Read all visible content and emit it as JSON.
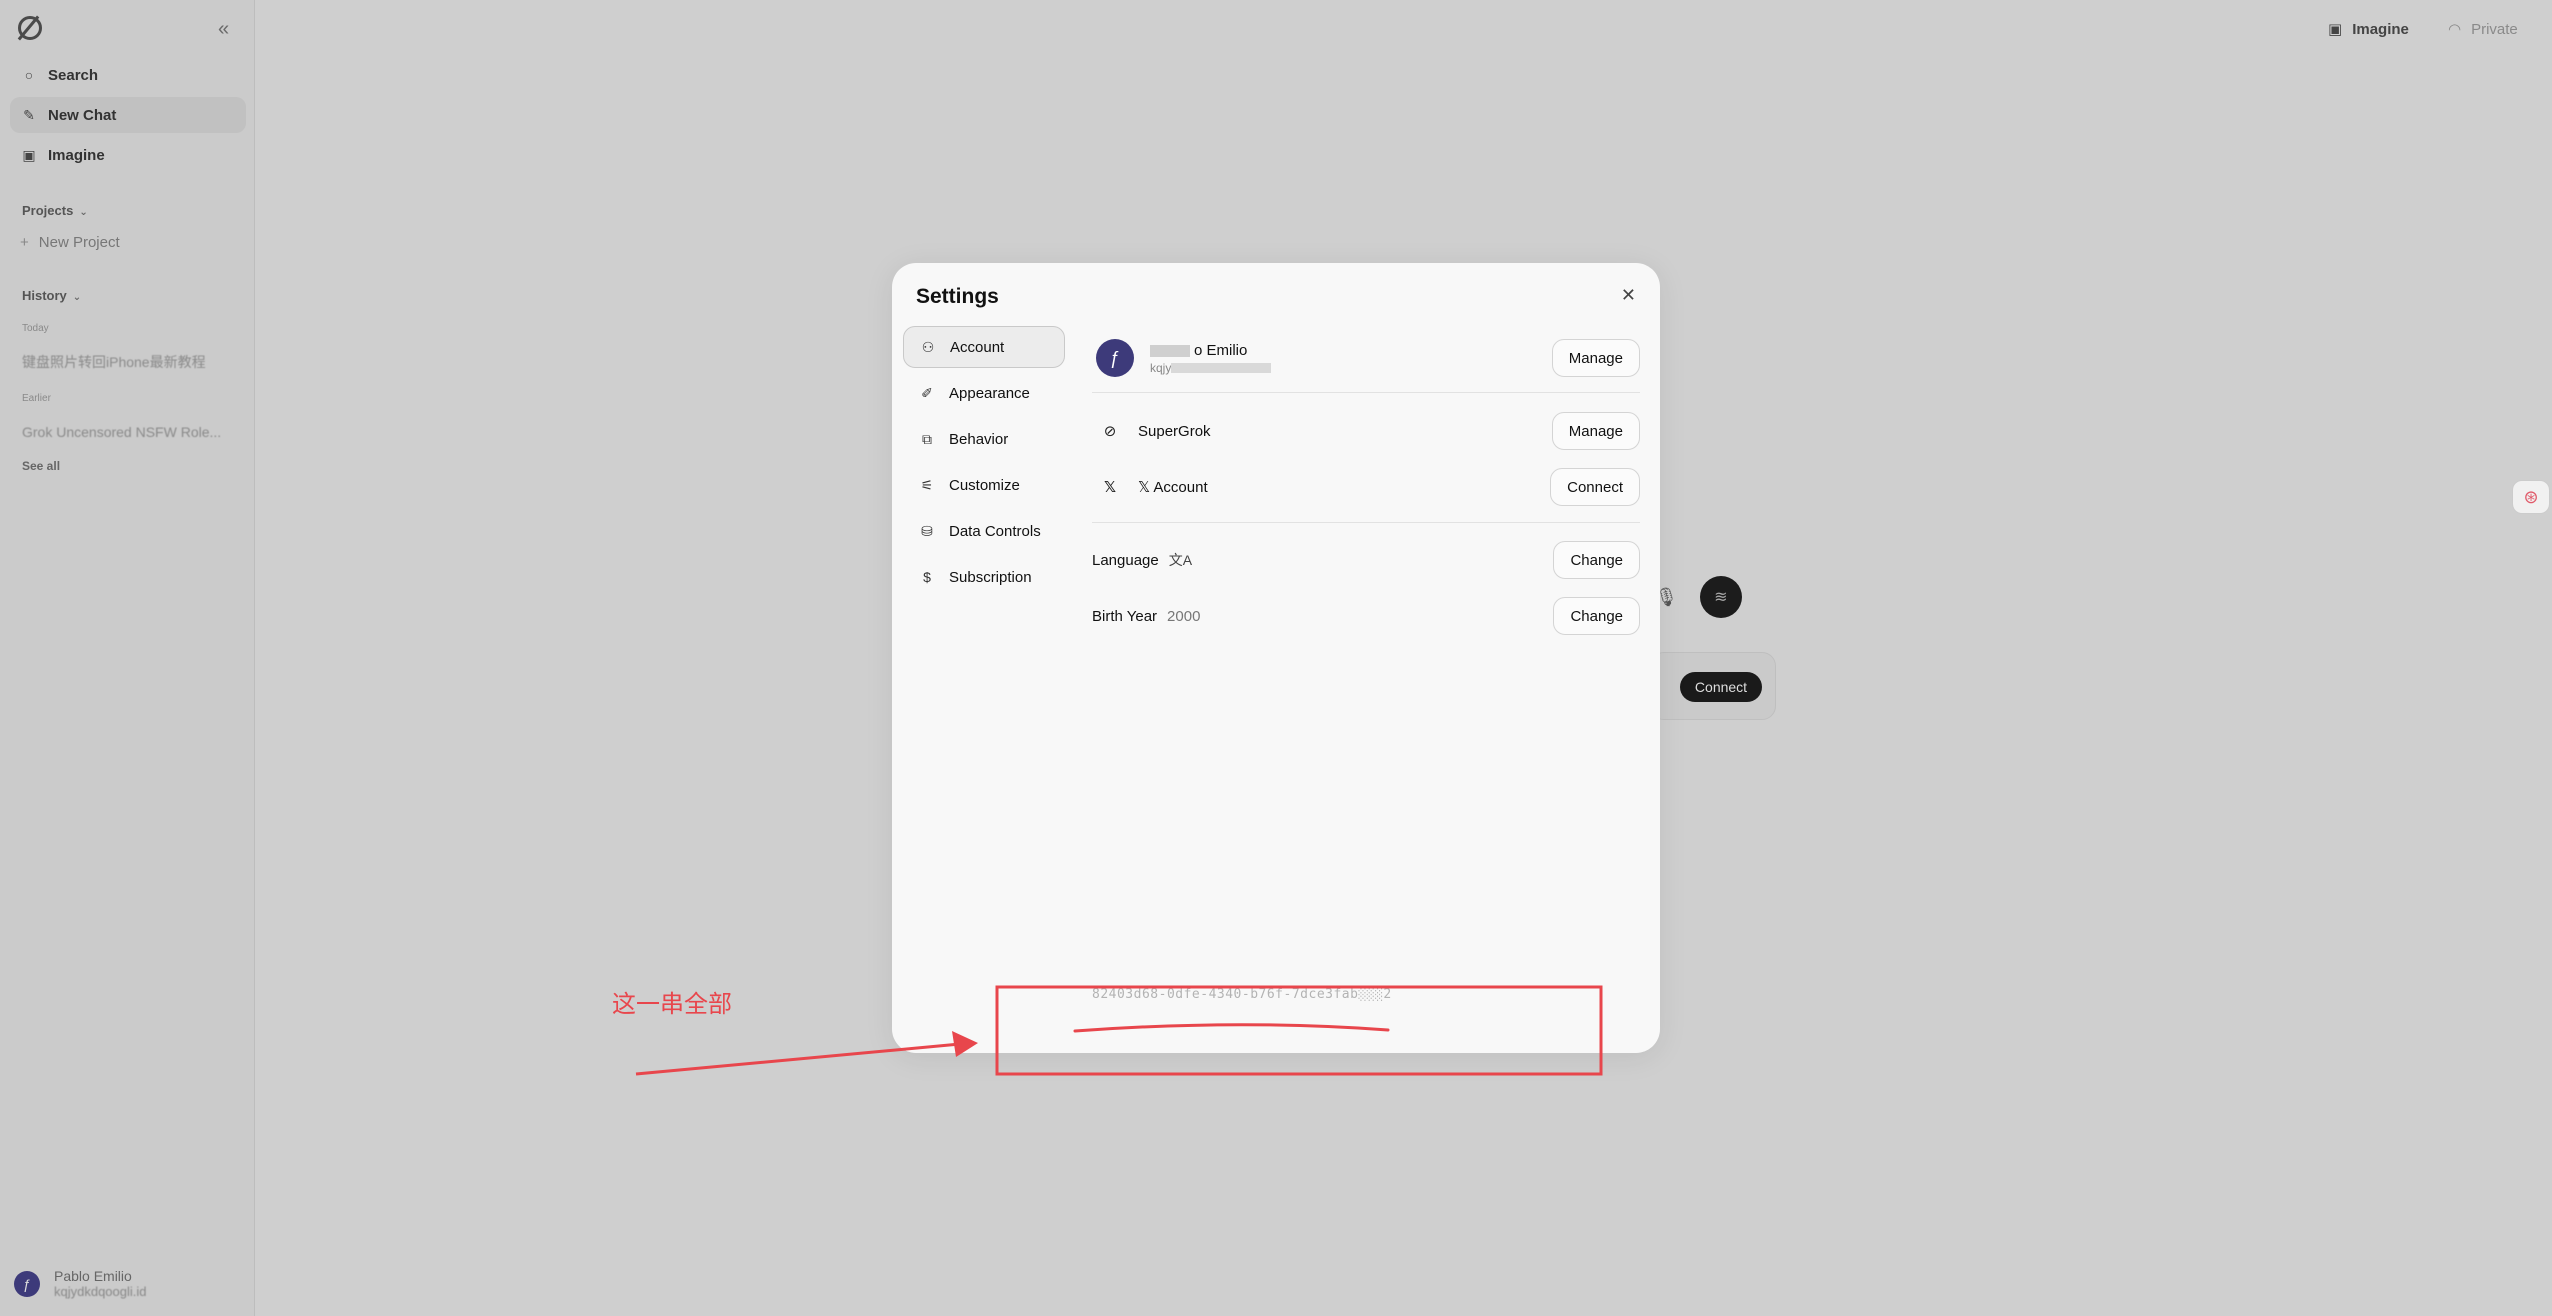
{
  "sidebar": {
    "items": [
      {
        "label": "Search",
        "icon": "search-icon"
      },
      {
        "label": "New Chat",
        "icon": "edit-icon"
      },
      {
        "label": "Imagine",
        "icon": "image-icon"
      }
    ],
    "projects_title": "Projects",
    "new_project": "New Project",
    "history_title": "History",
    "today_label": "Today",
    "today_item": "键盘照片转回iPhone最新教程",
    "earlier_label": "Earlier",
    "earlier_item": "Grok Uncensored NSFW Role...",
    "see_all": "See all",
    "user_name": "Pablo Emilio",
    "user_email": "kqjydkdqoogli.id"
  },
  "topbar": {
    "imagine": "Imagine",
    "private": "Private"
  },
  "background": {
    "connect": "Connect"
  },
  "settings": {
    "title": "Settings",
    "menu": [
      {
        "label": "Account",
        "icon": "person-icon",
        "active": true
      },
      {
        "label": "Appearance",
        "icon": "brush-icon"
      },
      {
        "label": "Behavior",
        "icon": "behavior-icon"
      },
      {
        "label": "Customize",
        "icon": "sliders-icon"
      },
      {
        "label": "Data Controls",
        "icon": "database-icon"
      },
      {
        "label": "Subscription",
        "icon": "dollar-icon"
      }
    ],
    "account": {
      "name_suffix": "o Emilio",
      "email_prefix": "kqjy",
      "manage_label": "Manage",
      "supergrok_label": "SuperGrok",
      "supergrok_button": "Manage",
      "x_label": "𝕏 Account",
      "x_button": "Connect",
      "language_label": "Language",
      "language_button": "Change",
      "birth_label": "Birth Year",
      "birth_value": "2000",
      "birth_button": "Change"
    },
    "user_id": "82403d68-0dfe-4340-b76f-7dce3fab░░░2"
  },
  "annotation": {
    "text": "这一串全部",
    "color": "#e8464c"
  }
}
